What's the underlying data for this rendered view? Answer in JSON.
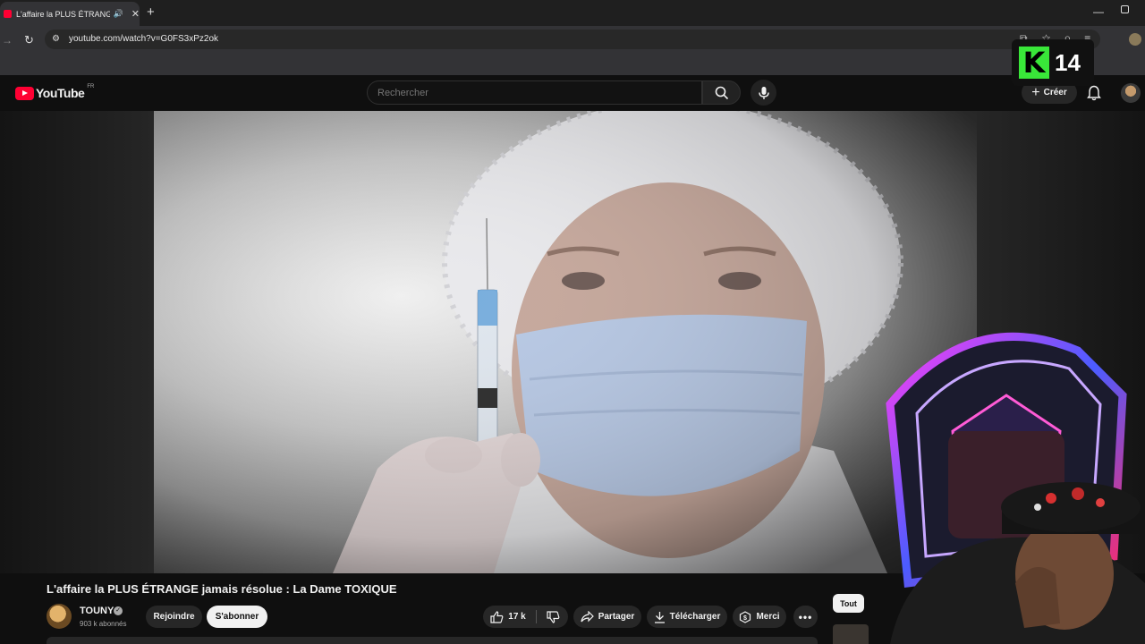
{
  "browser": {
    "tab_title": "L'affaire la PLUS ÉTRANGE jamais résolue : La Dame TOXIQUE",
    "url": "youtube.com/watch?v=G0FS3xPz2ok"
  },
  "youtube": {
    "logo_text": "YouTube",
    "country_code": "FR",
    "search_placeholder": "Rechercher",
    "create_label": "Créer"
  },
  "overlay": {
    "badge_number": "14"
  },
  "video": {
    "title": "L'affaire la PLUS ÉTRANGE jamais résolue : La Dame TOXIQUE",
    "channel_name": "TOUNY",
    "subscribers": "903 k abonnés",
    "join_label": "Rejoindre",
    "subscribe_label": "S'abonner",
    "likes": "17 k",
    "share_label": "Partager",
    "download_label": "Télécharger",
    "thanks_label": "Merci"
  },
  "sidebar": {
    "chip_all": "Tout"
  },
  "colors": {
    "brand_red": "#ff0033",
    "k14_green": "#39e639",
    "background": "#0f0f0f"
  }
}
